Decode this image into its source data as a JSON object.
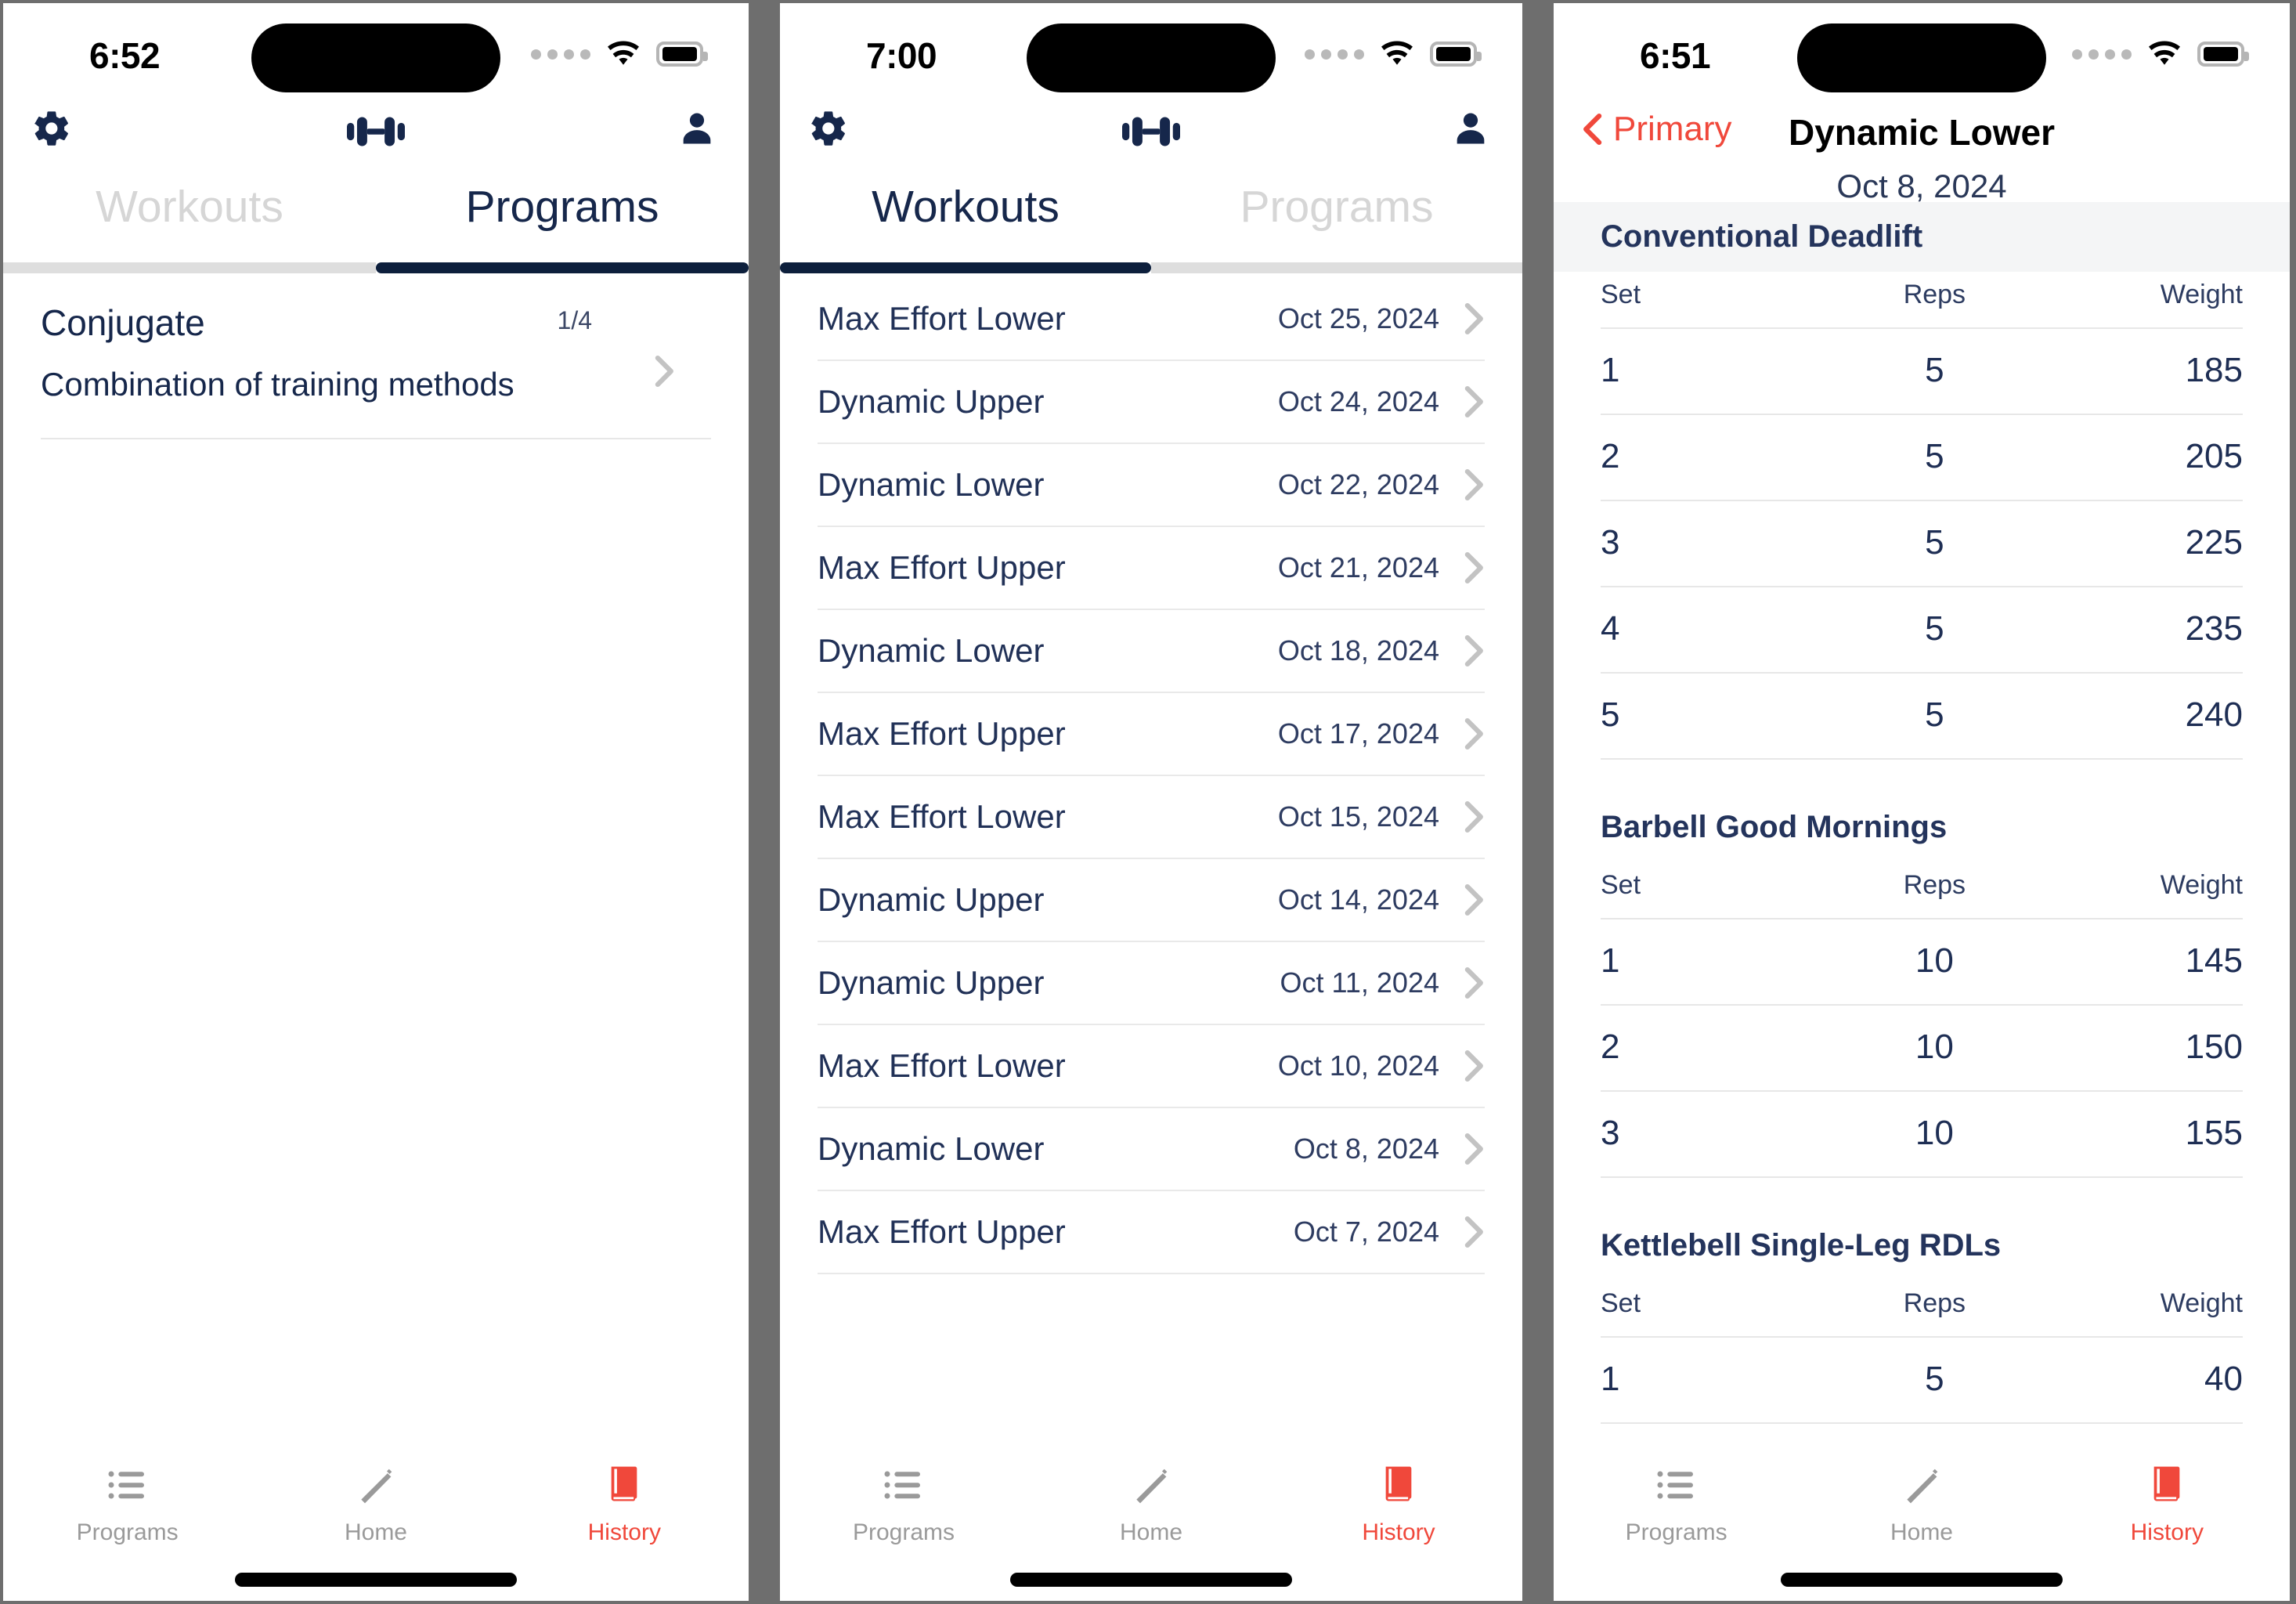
{
  "colors": {
    "navy": "#16274b",
    "accent_red": "#f0483b",
    "muted_gray": "#d6d6d6",
    "tab_indicator": "#0d1f3c",
    "section_shade": "#f4f5f6"
  },
  "panel1": {
    "status": {
      "time": "6:52",
      "cell_icon": "cellular-dots-icon",
      "wifi_icon": "wifi-icon",
      "battery_icon": "battery-icon"
    },
    "header": {
      "settings_icon": "gear-icon",
      "logo_icon": "dumbbell-icon",
      "profile_icon": "person-icon"
    },
    "tabs": [
      {
        "label": "Workouts",
        "active": false
      },
      {
        "label": "Programs",
        "active": true
      }
    ],
    "programs": [
      {
        "title": "Conjugate",
        "subtitle": "Combination of training methods",
        "count": "1/4",
        "chevron_icon": "chevron-right-icon"
      }
    ],
    "tabbar": [
      {
        "label": "Programs",
        "icon": "list-icon",
        "active": false
      },
      {
        "label": "Home",
        "icon": "pencil-icon",
        "active": false
      },
      {
        "label": "History",
        "icon": "book-icon",
        "active": true
      }
    ]
  },
  "panel2": {
    "status": {
      "time": "7:00",
      "cell_icon": "cellular-dots-icon",
      "wifi_icon": "wifi-icon",
      "battery_icon": "battery-icon"
    },
    "header": {
      "settings_icon": "gear-icon",
      "logo_icon": "dumbbell-icon",
      "profile_icon": "person-icon"
    },
    "tabs": [
      {
        "label": "Workouts",
        "active": true
      },
      {
        "label": "Programs",
        "active": false
      }
    ],
    "workouts": [
      {
        "name": "Max Effort Lower",
        "date": "Oct 25, 2024"
      },
      {
        "name": "Dynamic Upper",
        "date": "Oct 24, 2024"
      },
      {
        "name": "Dynamic Lower",
        "date": "Oct 22, 2024"
      },
      {
        "name": "Max Effort Upper",
        "date": "Oct 21, 2024"
      },
      {
        "name": "Dynamic Lower",
        "date": "Oct 18, 2024"
      },
      {
        "name": "Max Effort Upper",
        "date": "Oct 17, 2024"
      },
      {
        "name": "Max Effort Lower",
        "date": "Oct 15, 2024"
      },
      {
        "name": "Dynamic Upper",
        "date": "Oct 14, 2024"
      },
      {
        "name": "Dynamic Upper",
        "date": "Oct 11, 2024"
      },
      {
        "name": "Max Effort Lower",
        "date": "Oct 10, 2024"
      },
      {
        "name": "Dynamic Lower",
        "date": "Oct 8, 2024"
      },
      {
        "name": "Max Effort Upper",
        "date": "Oct 7, 2024"
      }
    ],
    "tabbar": [
      {
        "label": "Programs",
        "icon": "list-icon",
        "active": false
      },
      {
        "label": "Home",
        "icon": "pencil-icon",
        "active": false
      },
      {
        "label": "History",
        "icon": "book-icon",
        "active": true
      }
    ]
  },
  "panel3": {
    "status": {
      "time": "6:51",
      "cell_icon": "cellular-dots-icon",
      "wifi_icon": "wifi-icon",
      "battery_icon": "battery-icon"
    },
    "nav": {
      "back_label": "Primary",
      "back_icon": "chevron-left-icon",
      "title": "Dynamic Lower",
      "date": "Oct 8, 2024"
    },
    "columns": {
      "set": "Set",
      "reps": "Reps",
      "weight": "Weight"
    },
    "exercises": [
      {
        "name": "Conventional Deadlift",
        "shaded": true,
        "sets": [
          {
            "set": "1",
            "reps": "5",
            "weight": "185"
          },
          {
            "set": "2",
            "reps": "5",
            "weight": "205"
          },
          {
            "set": "3",
            "reps": "5",
            "weight": "225"
          },
          {
            "set": "4",
            "reps": "5",
            "weight": "235"
          },
          {
            "set": "5",
            "reps": "5",
            "weight": "240"
          }
        ]
      },
      {
        "name": "Barbell Good Mornings",
        "shaded": false,
        "sets": [
          {
            "set": "1",
            "reps": "10",
            "weight": "145"
          },
          {
            "set": "2",
            "reps": "10",
            "weight": "150"
          },
          {
            "set": "3",
            "reps": "10",
            "weight": "155"
          }
        ]
      },
      {
        "name": "Kettlebell Single-Leg RDLs",
        "shaded": false,
        "sets": [
          {
            "set": "1",
            "reps": "5",
            "weight": "40"
          }
        ]
      }
    ],
    "tabbar": [
      {
        "label": "Programs",
        "icon": "list-icon",
        "active": false
      },
      {
        "label": "Home",
        "icon": "pencil-icon",
        "active": false
      },
      {
        "label": "History",
        "icon": "book-icon",
        "active": true
      }
    ]
  }
}
